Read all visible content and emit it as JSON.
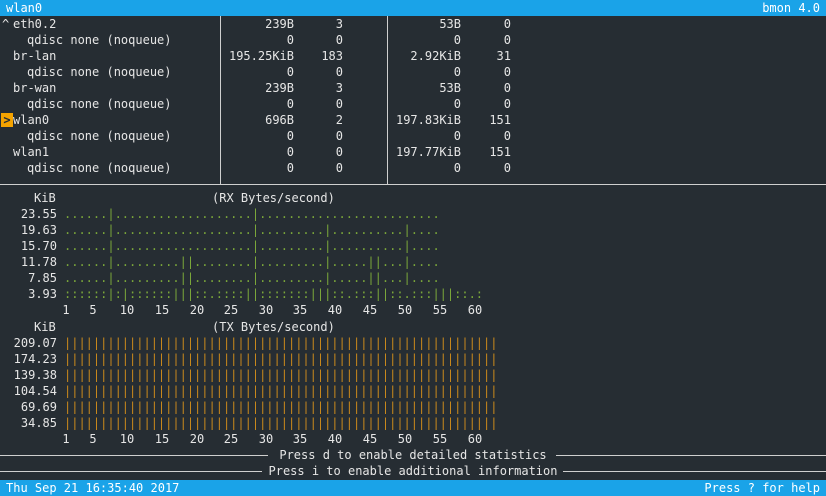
{
  "top_bar": {
    "selected_interface": "wlan0",
    "app_name": "bmon 4.0"
  },
  "interfaces": [
    {
      "label": "eth0.2",
      "indent": 1,
      "marker": "^",
      "selected": false,
      "rx_bytes": "239B",
      "rx_packets": "3",
      "tx_bytes": "53B",
      "tx_packets": "0"
    },
    {
      "label": "qdisc none (noqueue)",
      "indent": 2,
      "marker": "",
      "selected": false,
      "rx_bytes": "0",
      "rx_packets": "0",
      "tx_bytes": "0",
      "tx_packets": "0"
    },
    {
      "label": "br-lan",
      "indent": 1,
      "marker": "",
      "selected": false,
      "rx_bytes": "195.25KiB",
      "rx_packets": "183",
      "tx_bytes": "2.92KiB",
      "tx_packets": "31"
    },
    {
      "label": "qdisc none (noqueue)",
      "indent": 2,
      "marker": "",
      "selected": false,
      "rx_bytes": "0",
      "rx_packets": "0",
      "tx_bytes": "0",
      "tx_packets": "0"
    },
    {
      "label": "br-wan",
      "indent": 1,
      "marker": "",
      "selected": false,
      "rx_bytes": "239B",
      "rx_packets": "3",
      "tx_bytes": "53B",
      "tx_packets": "0"
    },
    {
      "label": "qdisc none (noqueue)",
      "indent": 2,
      "marker": "",
      "selected": false,
      "rx_bytes": "0",
      "rx_packets": "0",
      "tx_bytes": "0",
      "tx_packets": "0"
    },
    {
      "label": "wlan0",
      "indent": 1,
      "marker": ">",
      "selected": true,
      "rx_bytes": "696B",
      "rx_packets": "2",
      "tx_bytes": "197.83KiB",
      "tx_packets": "151"
    },
    {
      "label": "qdisc none (noqueue)",
      "indent": 2,
      "marker": "",
      "selected": false,
      "rx_bytes": "0",
      "rx_packets": "0",
      "tx_bytes": "0",
      "tx_packets": "0"
    },
    {
      "label": "wlan1",
      "indent": 1,
      "marker": "",
      "selected": false,
      "rx_bytes": "0",
      "rx_packets": "0",
      "tx_bytes": "197.77KiB",
      "tx_packets": "151"
    },
    {
      "label": "qdisc none (noqueue)",
      "indent": 2,
      "marker": "",
      "selected": false,
      "rx_bytes": "0",
      "rx_packets": "0",
      "tx_bytes": "0",
      "tx_packets": "0"
    }
  ],
  "rx_graph": {
    "unit": "KiB",
    "title": "(RX Bytes/second)",
    "y_labels": [
      "23.55",
      "19.63",
      "15.70",
      "11.78",
      "7.85",
      "3.93"
    ],
    "x_labels": [
      "1",
      "5",
      "10",
      "15",
      "20",
      "25",
      "30",
      "35",
      "40",
      "45",
      "50",
      "55",
      "60"
    ],
    "rows": [
      "......|...................|.........................",
      "......|...................|.........|..........|....",
      "......|...................|.........|..........|....",
      "......|.........||........|.........|.....||...|....",
      "......|.........||........|.........|.....||...|....",
      "::::::|:|::::::|||::.::::||:::::::|||::.:::||::.:::|||::.:"
    ],
    "color": "#7aa63a"
  },
  "tx_graph": {
    "unit": "KiB",
    "title": "(TX Bytes/second)",
    "y_labels": [
      "209.07",
      "174.23",
      "139.38",
      "104.54",
      "69.69",
      "34.85"
    ],
    "x_labels": [
      "1",
      "5",
      "10",
      "15",
      "20",
      "25",
      "30",
      "35",
      "40",
      "45",
      "50",
      "55",
      "60"
    ],
    "rows": [
      "||||||||||||||||||||||||||||||||||||||||||||||||||||||||||||",
      "||||||||||||||||||||||||||||||||||||||||||||||||||||||||||||",
      "||||||||||||||||||||||||||||||||||||||||||||||||||||||||||||",
      "||||||||||||||||||||||||||||||||||||||||||||||||||||||||||||",
      "||||||||||||||||||||||||||||||||||||||||||||||||||||||||||||",
      "||||||||||||||||||||||||||||||||||||||||||||||||||||||||||||"
    ],
    "color": "#c8881c"
  },
  "hints": [
    "Press d to enable detailed statistics",
    "Press i to enable additional information"
  ],
  "bottom_bar": {
    "datetime": "Thu Sep 21 16:35:40 2017",
    "help_hint": "Press ? for help"
  }
}
